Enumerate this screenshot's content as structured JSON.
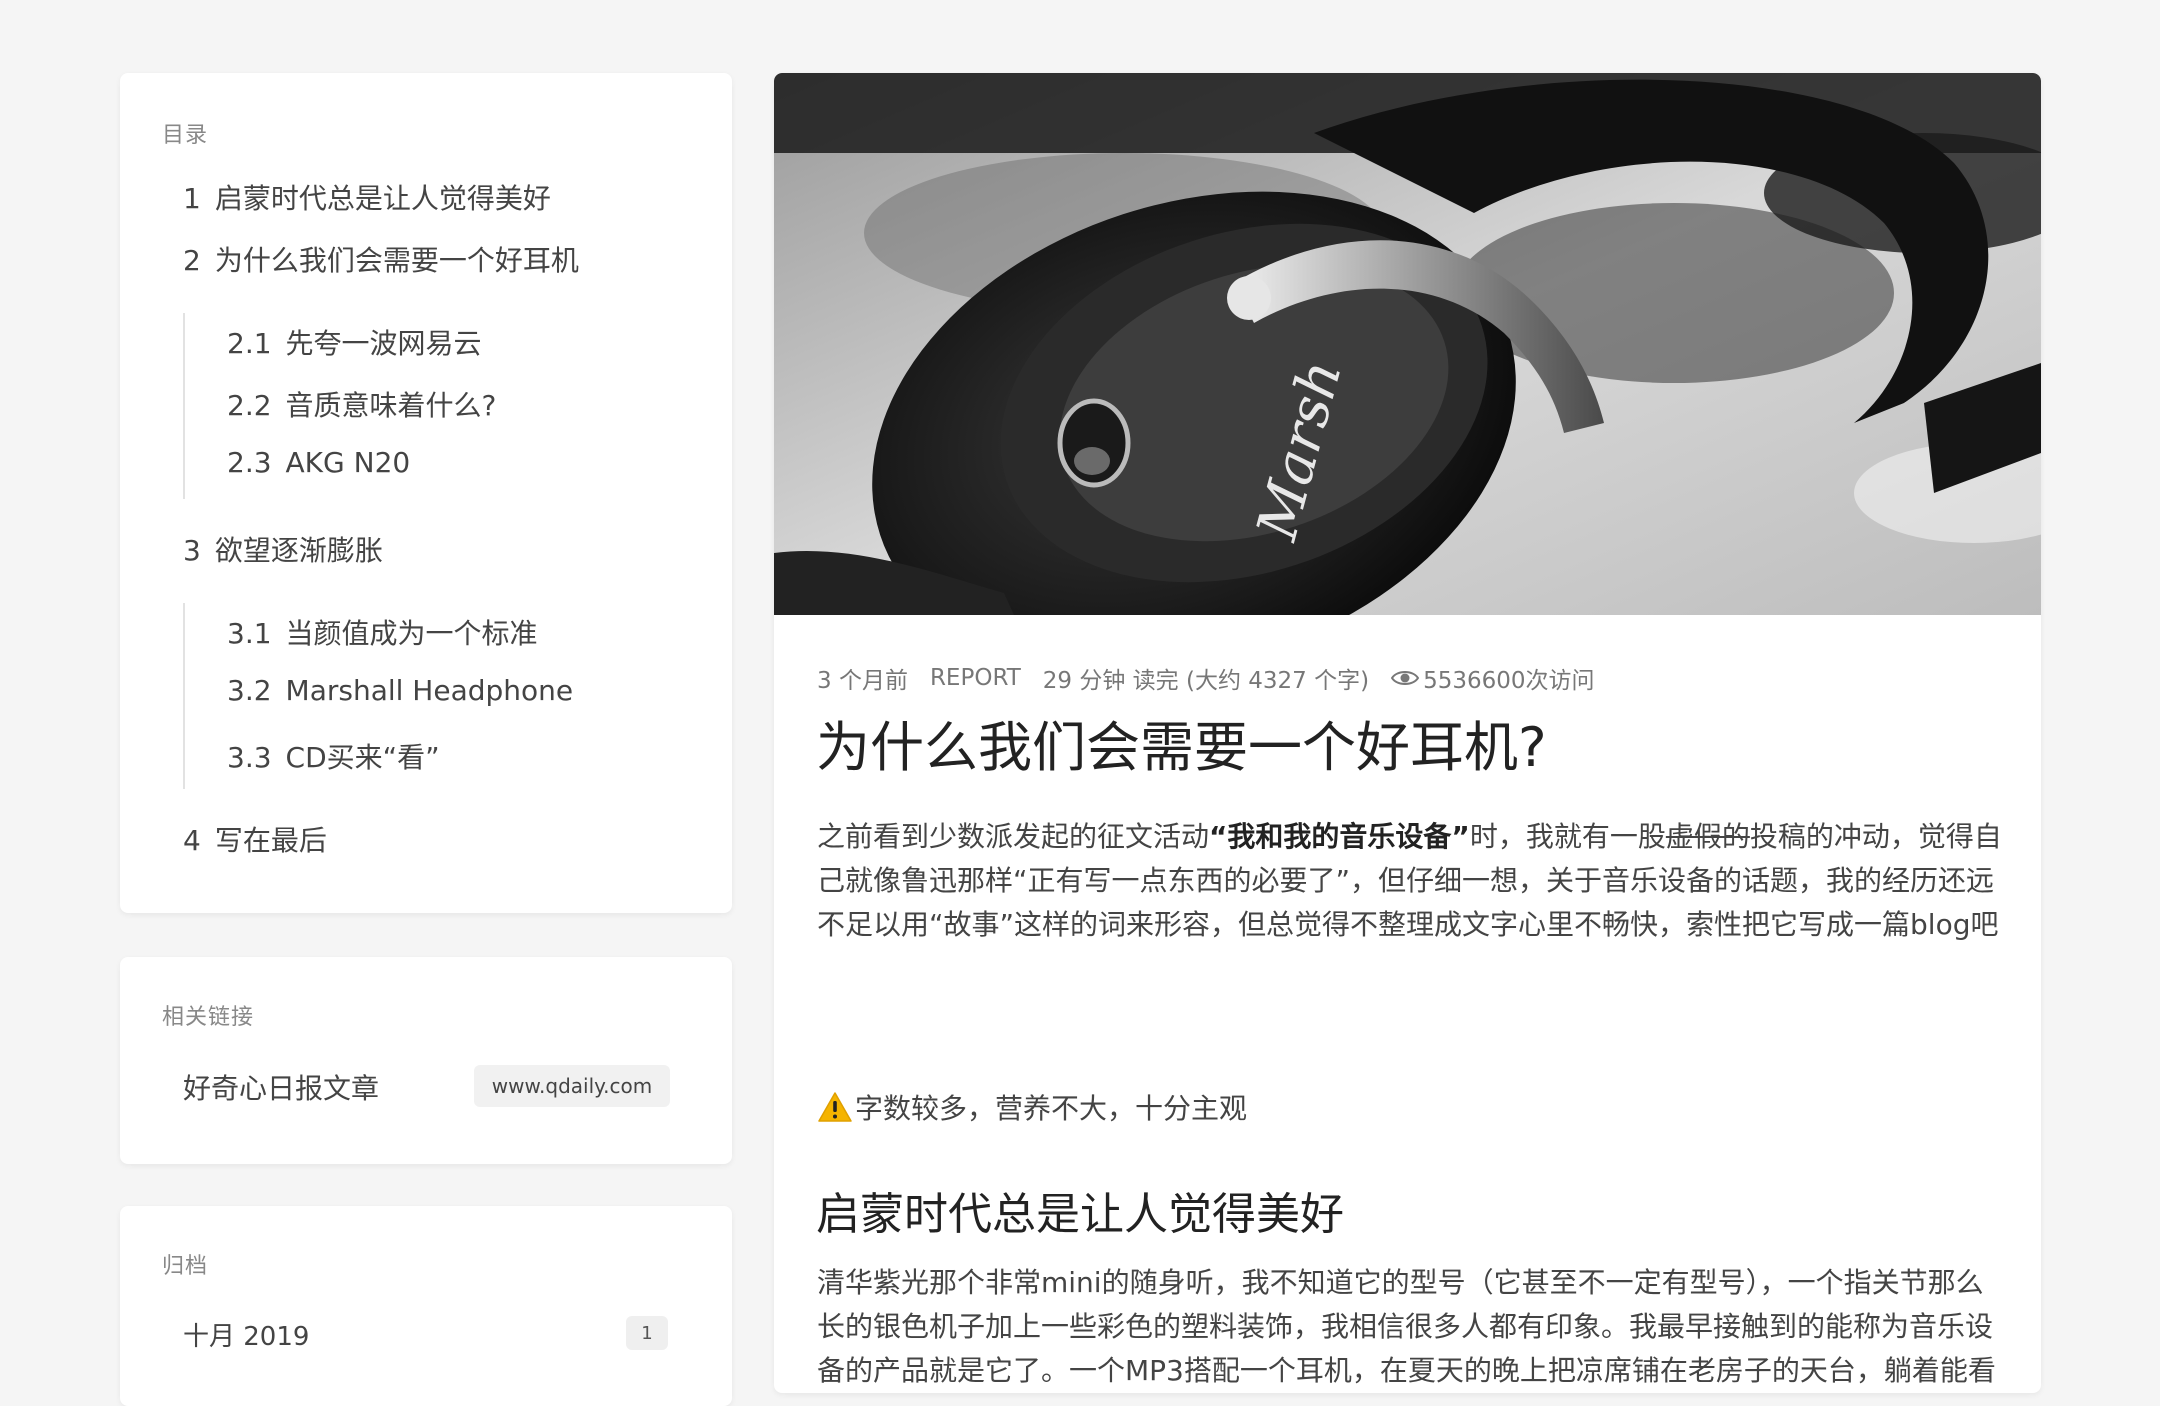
{
  "toc": {
    "heading": "目录",
    "items": [
      {
        "num": "1",
        "label": "启蒙时代总是让人觉得美好"
      },
      {
        "num": "2",
        "label": "为什么我们会需要一个好耳机"
      },
      {
        "num": "2.1",
        "label": "先夸一波网易云"
      },
      {
        "num": "2.2",
        "label": "音质意味着什么?"
      },
      {
        "num": "2.3",
        "label": "AKG N20"
      },
      {
        "num": "3",
        "label": "欲望逐渐膨胀"
      },
      {
        "num": "3.1",
        "label": "当颜值成为一个标准"
      },
      {
        "num": "3.2",
        "label": "Marshall Headphone"
      },
      {
        "num": "3.3",
        "label": "CD买来“看”"
      },
      {
        "num": "4",
        "label": "写在最后"
      }
    ]
  },
  "links": {
    "heading": "相关链接",
    "item_label": "好奇心日报文章",
    "item_domain": "www.qdaily.com"
  },
  "archive": {
    "heading": "归档",
    "item_label": "十月 2019",
    "item_count": "1"
  },
  "article": {
    "hero_icon": "headphones-photo",
    "meta": {
      "time": "3 个月前",
      "category": "REPORT",
      "reading": "29 分钟 读完 (大约 4327 个字)",
      "views": "5536600次访问"
    },
    "title": "为什么我们会需要一个好耳机?",
    "intro": {
      "p1": "之前看到少数派发起的征文活动",
      "bold": "“我和我的音乐设备”",
      "p2": "时，我就有一股",
      "strike": "虚假的",
      "p3": "投稿的冲动，觉得自己就像鲁迅那样“正有写一点东西的必要了”，但仔细一想，关于音乐设备的话题，我的经历还远不足以用“故事”这样的词来形容，但总觉得不整理成文字心里不畅快，索性把它写成一篇blog吧"
    },
    "warning": "字数较多，营养不大，十分主观",
    "section1_title": "启蒙时代总是让人觉得美好",
    "section1_body": "清华紫光那个非常mini的随身听，我不知道它的型号（它甚至不一定有型号），一个指关节那么长的银色机子加上一些彩色的塑料装饰，我相信很多人都有印象。我最早接触到的能称为音乐设备的产品就是它了。一个MP3搭配一个耳机，在夏天的晚上把凉席铺在老房子的天台，躺着能看见星星，你会觉得随身听里传出的声音就是你所处这个世界"
  }
}
